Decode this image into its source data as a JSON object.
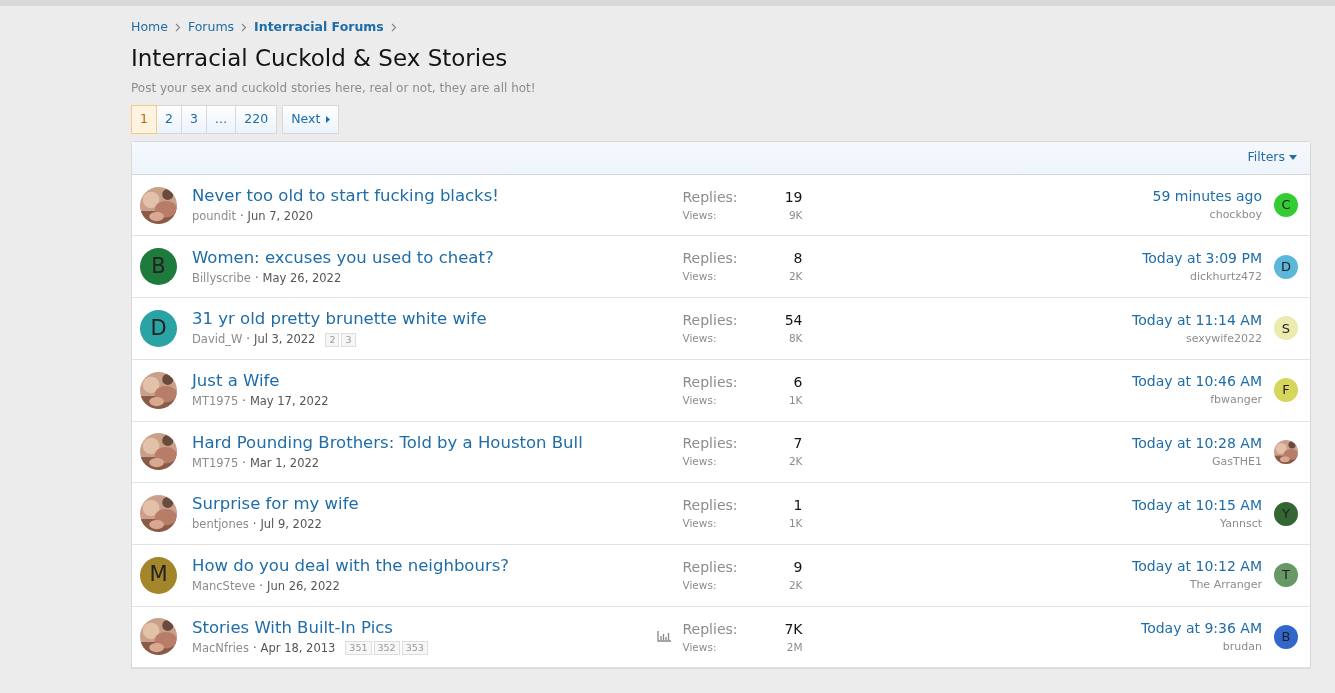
{
  "breadcrumbs": [
    {
      "label": "Home",
      "current": false
    },
    {
      "label": "Forums",
      "current": false
    },
    {
      "label": "Interracial Forums",
      "current": true
    }
  ],
  "title": "Interracial Cuckold & Sex Stories",
  "description": "Post your sex and cuckold stories here, real or not, they are all hot!",
  "pagination": {
    "pages": [
      {
        "label": "1",
        "selected": true
      },
      {
        "label": "2",
        "selected": false
      },
      {
        "label": "3",
        "selected": false
      },
      {
        "label": "…",
        "selected": false
      },
      {
        "label": "220",
        "selected": false
      }
    ],
    "next": "Next"
  },
  "filters": "Filters",
  "threads": [
    {
      "title": "Never too old to start fucking blacks!",
      "author": "poundit",
      "separator": "·",
      "date": "Jun 7, 2020",
      "poll": false,
      "replies_label": "Replies:",
      "replies": "19",
      "views_label": "Views:",
      "views": "9K",
      "last_time": "59 minutes ago",
      "last_user": "chockboy",
      "last_avatar": {
        "kind": "letter",
        "letter": "C",
        "color": "#33cc33"
      }
    },
    {
      "title": "Women: excuses you used to cheat?",
      "author": "Billyscribe",
      "separator": "·",
      "date": "May 26, 2022",
      "poll": false,
      "avatar": {
        "kind": "letter",
        "letter": "B",
        "color": "#1f7a3d"
      },
      "replies_label": "Replies:",
      "replies": "8",
      "views_label": "Views:",
      "views": "2K",
      "last_time": "Today at 3:09 PM",
      "last_user": "dickhurtz472",
      "last_avatar": {
        "kind": "letter",
        "letter": "D",
        "color": "#5bb8db"
      }
    },
    {
      "title": "31 yr old pretty brunette white wife",
      "author": "David_W",
      "separator": "·",
      "date": "Jul 3, 2022",
      "pages": [
        "2",
        "3"
      ],
      "poll": false,
      "avatar": {
        "kind": "letter",
        "letter": "D",
        "color": "#29a3a3"
      },
      "replies_label": "Replies:",
      "replies": "54",
      "views_label": "Views:",
      "views": "8K",
      "last_time": "Today at 11:14 AM",
      "last_user": "sexywife2022",
      "last_avatar": {
        "kind": "letter",
        "letter": "S",
        "color": "#ebebb0"
      }
    },
    {
      "title": "Just a Wife",
      "author": "MT1975",
      "separator": "·",
      "date": "May 17, 2022",
      "poll": false,
      "replies_label": "Replies:",
      "replies": "6",
      "views_label": "Views:",
      "views": "1K",
      "last_time": "Today at 10:46 AM",
      "last_user": "fbwanger",
      "last_avatar": {
        "kind": "letter",
        "letter": "F",
        "color": "#d6d65c"
      }
    },
    {
      "title": "Hard Pounding Brothers: Told by a Houston Bull",
      "author": "MT1975",
      "separator": "·",
      "date": "Mar 1, 2022",
      "poll": false,
      "replies_label": "Replies:",
      "replies": "7",
      "views_label": "Views:",
      "views": "2K",
      "last_time": "Today at 10:28 AM",
      "last_user": "GasTHE1"
    },
    {
      "title": "Surprise for my wife",
      "author": "bentjones",
      "separator": "·",
      "date": "Jul 9, 2022",
      "poll": false,
      "replies_label": "Replies:",
      "replies": "1",
      "views_label": "Views:",
      "views": "1K",
      "last_time": "Today at 10:15 AM",
      "last_user": "Yannsct",
      "last_avatar": {
        "kind": "letter",
        "letter": "Y",
        "color": "#336633"
      }
    },
    {
      "title": "How do you deal with the neighbours?",
      "author": "MancSteve",
      "separator": "·",
      "date": "Jun 26, 2022",
      "poll": false,
      "avatar": {
        "kind": "letter",
        "letter": "M",
        "color": "#a3852a"
      },
      "replies_label": "Replies:",
      "replies": "9",
      "views_label": "Views:",
      "views": "2K",
      "last_time": "Today at 10:12 AM",
      "last_user": "The Arranger",
      "last_avatar": {
        "kind": "letter",
        "letter": "T",
        "color": "#669966"
      }
    },
    {
      "title": "Stories With Built-In Pics",
      "author": "MacNfries",
      "separator": "·",
      "date": "Apr 18, 2013",
      "pages": [
        "351",
        "352",
        "353"
      ],
      "poll": true,
      "replies_label": "Replies:",
      "replies": "7K",
      "views_label": "Views:",
      "views": "2M",
      "last_time": "Today at 9:36 AM",
      "last_user": "brudan",
      "last_avatar": {
        "kind": "letter",
        "letter": "B",
        "color": "#3366cc"
      }
    }
  ]
}
